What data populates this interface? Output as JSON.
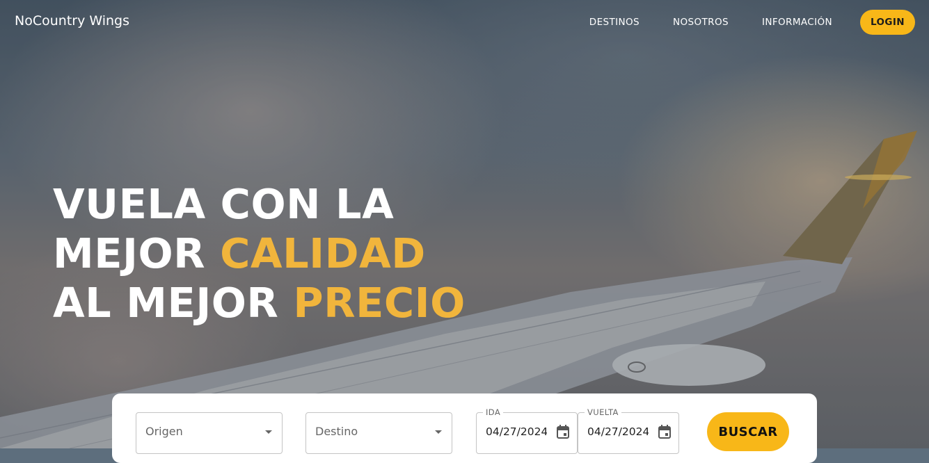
{
  "brand": "NoCountry Wings",
  "nav": {
    "links": [
      "DESTINOS",
      "NOSOTROS",
      "INFORMACIÓN"
    ],
    "login": "LOGIN"
  },
  "hero": {
    "line1": "VUELA CON LA",
    "line2_a": "MEJOR",
    "line2_b": "CALIDAD",
    "line3_a": "AL MEJOR",
    "line3_b": "PRECIO"
  },
  "search": {
    "origin_placeholder": "Origen",
    "destination_placeholder": "Destino",
    "ida_label": "IDA",
    "ida_value": "04/27/2024",
    "vuelta_label": "VUELTA",
    "vuelta_value": "04/27/2024",
    "button": "BUSCAR"
  },
  "colors": {
    "accent": "#f8b718",
    "headline_accent": "#f1b53c"
  }
}
